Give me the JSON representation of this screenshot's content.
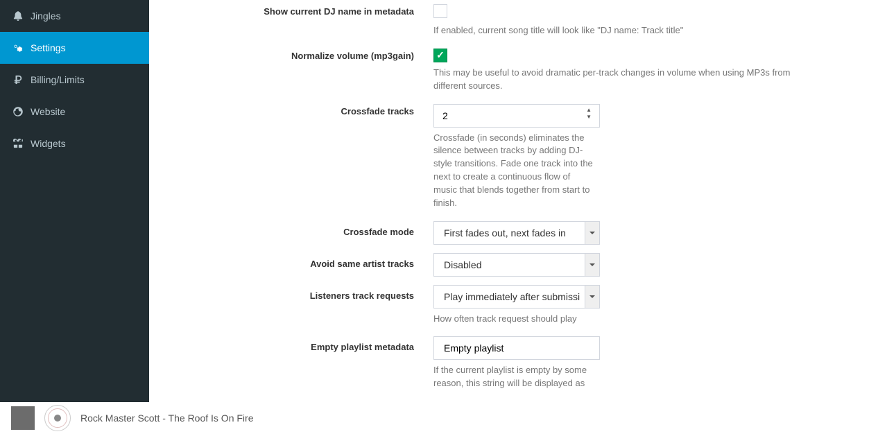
{
  "sidebar": {
    "items": [
      {
        "label": "Jingles"
      },
      {
        "label": "Settings"
      },
      {
        "label": "Billing/Limits"
      },
      {
        "label": "Website"
      },
      {
        "label": "Widgets"
      }
    ]
  },
  "form": {
    "show_dj": {
      "label": "Show current DJ name in metadata",
      "help": "If enabled, current song title will look like \"DJ name: Track title\""
    },
    "normalize": {
      "label": "Normalize volume (mp3gain)",
      "help": "This may be useful to avoid dramatic per-track changes in volume when using MP3s from different sources."
    },
    "crossfade": {
      "label": "Crossfade tracks",
      "value": "2",
      "help": "Crossfade (in seconds) eliminates the silence between tracks by adding DJ-style transitions. Fade one track into the next to create a continuous flow of music that blends together from start to finish."
    },
    "crossfade_mode": {
      "label": "Crossfade mode",
      "value": "First fades out, next fades in"
    },
    "avoid_artist": {
      "label": "Avoid same artist tracks",
      "value": "Disabled"
    },
    "track_requests": {
      "label": "Listeners track requests",
      "value": "Play immediately after submissi",
      "help": "How often track request should play"
    },
    "empty_playlist": {
      "label": "Empty playlist metadata",
      "value": "Empty playlist",
      "help": "If the current playlist is empty by some reason, this string will be displayed as"
    }
  },
  "footer": {
    "now_playing": "Rock Master Scott - The Roof Is On Fire"
  }
}
